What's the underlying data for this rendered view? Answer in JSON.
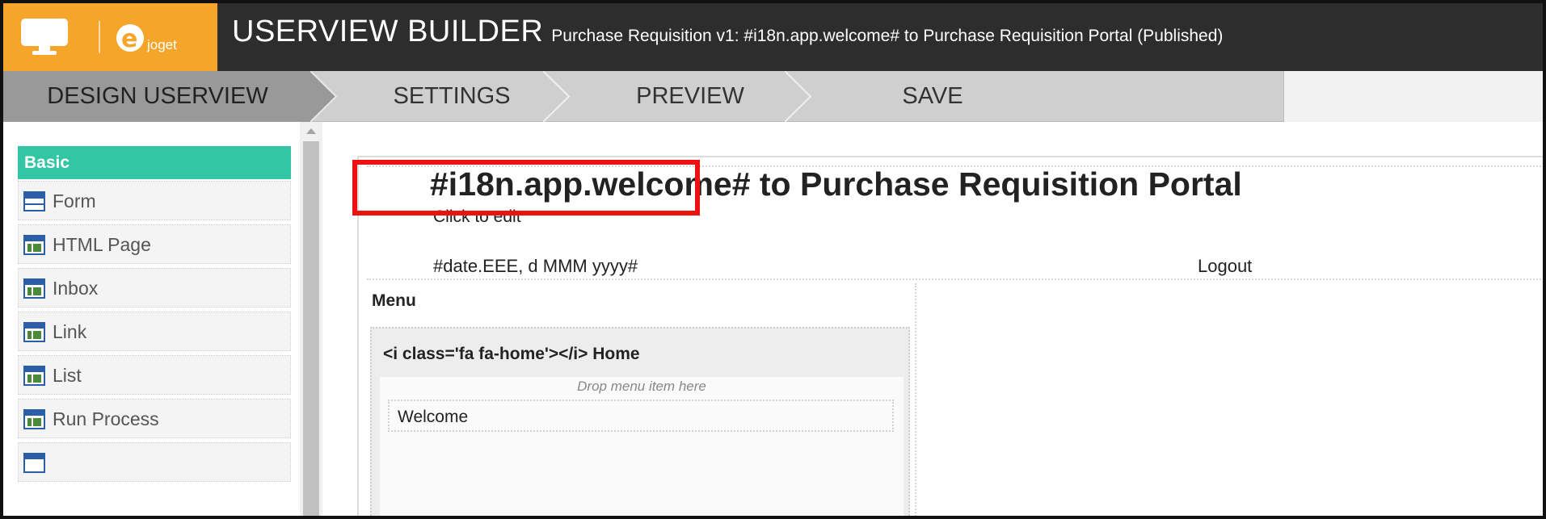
{
  "header": {
    "logo_text": "joget",
    "title": "USERVIEW BUILDER",
    "subtitle": "Purchase Requisition v1: #i18n.app.welcome# to Purchase Requisition Portal (Published)"
  },
  "steps": [
    {
      "label": "DESIGN USERVIEW"
    },
    {
      "label": "SETTINGS"
    },
    {
      "label": "PREVIEW"
    },
    {
      "label": "SAVE"
    }
  ],
  "palette": {
    "category": "Basic",
    "items": [
      {
        "label": "Form",
        "icon": "form-icon"
      },
      {
        "label": "HTML Page",
        "icon": "html-page-icon"
      },
      {
        "label": "Inbox",
        "icon": "inbox-icon"
      },
      {
        "label": "Link",
        "icon": "link-icon"
      },
      {
        "label": "List",
        "icon": "list-icon"
      },
      {
        "label": "Run Process",
        "icon": "run-process-icon"
      }
    ]
  },
  "canvas": {
    "title": "#i18n.app.welcome# to Purchase Requisition Portal",
    "click_to_edit": "Click to edit",
    "date": "#date.EEE, d MMM yyyy#",
    "logout": "Logout",
    "menu_label": "Menu",
    "category_label": "<i class='fa fa-home'></i> Home",
    "drop_hint": "Drop menu item here",
    "menu_items": [
      {
        "label": "Welcome"
      }
    ]
  },
  "colors": {
    "header_bg": "#2d2d2d",
    "logo_bg": "#f4a52a",
    "palette_header": "#33c6a5",
    "highlight": "#ee1111"
  }
}
